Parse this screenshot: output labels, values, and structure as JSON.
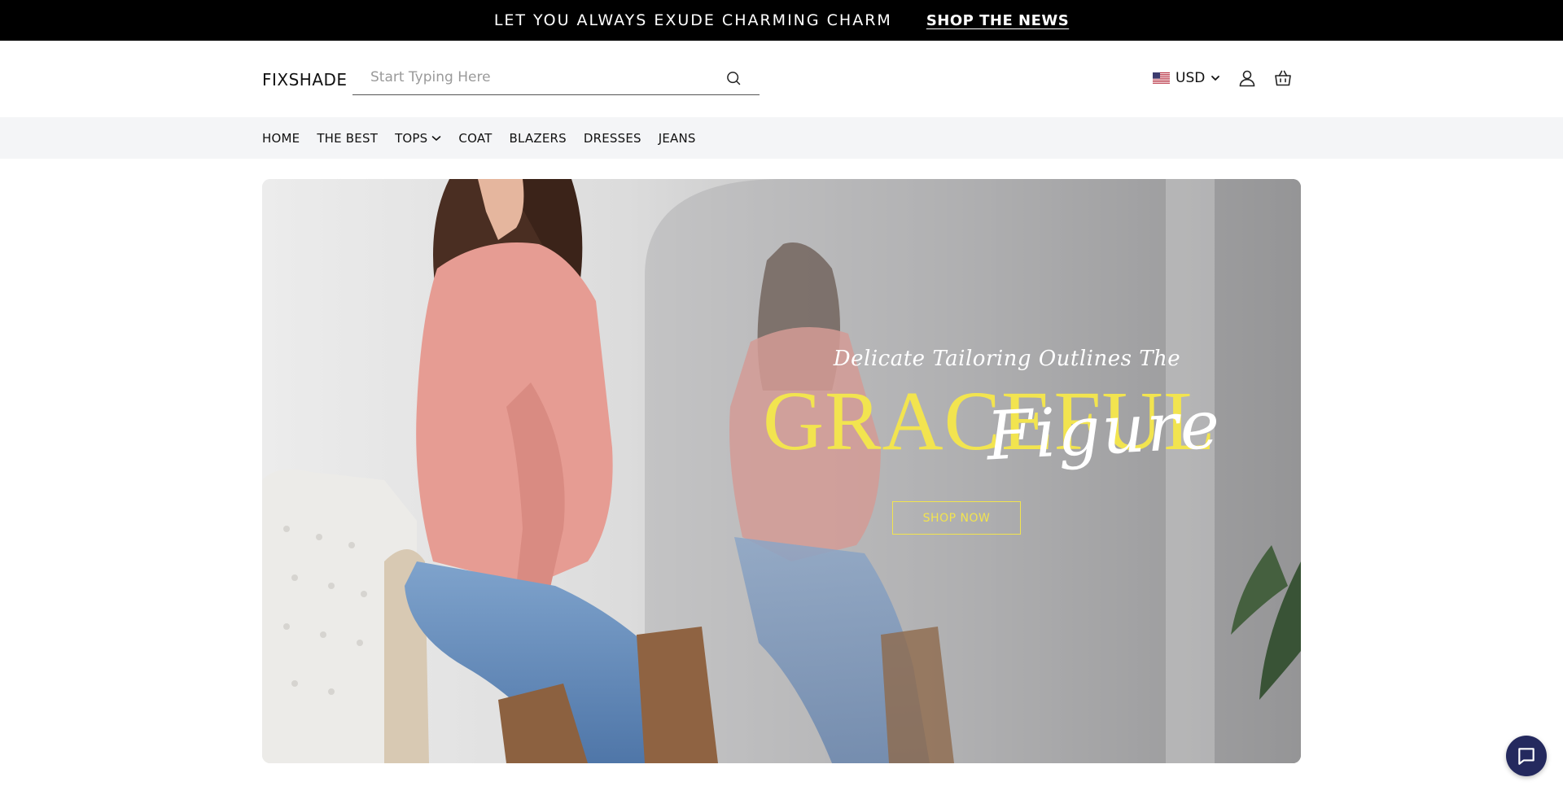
{
  "announcement": {
    "message": "LET YOU ALWAYS EXUDE CHARMING CHARM",
    "link": "SHOP THE NEWS"
  },
  "header": {
    "logo": "FIXSHADE",
    "search_placeholder": "Start Typing Here",
    "search_value": "",
    "currency": "USD"
  },
  "nav": {
    "items": [
      {
        "label": "HOME"
      },
      {
        "label": "THE BEST"
      },
      {
        "label": "TOPS",
        "has_dropdown": true
      },
      {
        "label": "COAT"
      },
      {
        "label": "BLAZERS"
      },
      {
        "label": "DRESSES"
      },
      {
        "label": "JEANS"
      }
    ]
  },
  "hero": {
    "tagline": "Delicate Tailoring Outlines The",
    "headline": "GRACEFUL",
    "script": "Figure",
    "cta": "SHOP NOW"
  },
  "colors": {
    "announcement_bg": "#000000",
    "nav_bg": "#f4f5f7",
    "accent_yellow": "#f2e44f",
    "chat_bg": "#24295e"
  },
  "icons": {
    "search": "search-icon",
    "flag": "us-flag-icon",
    "account": "user-icon",
    "cart": "shopping-bag-icon",
    "chat": "chat-bubble-icon"
  }
}
